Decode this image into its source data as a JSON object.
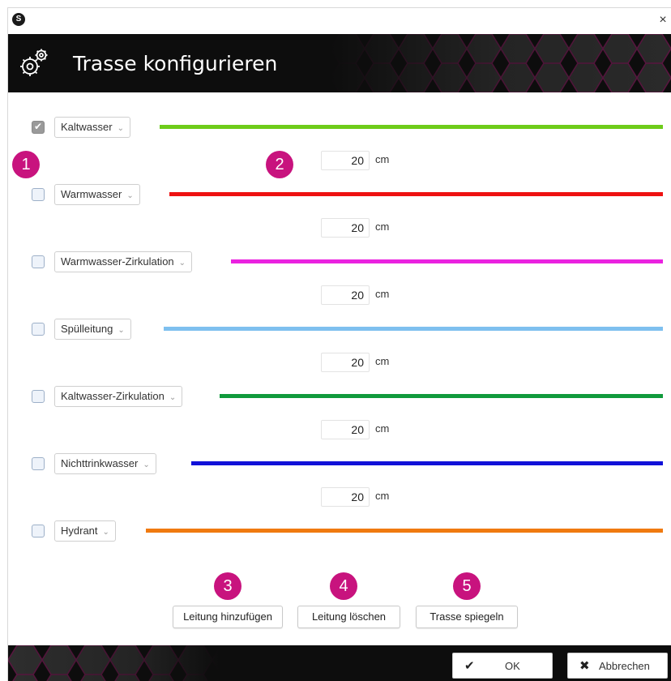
{
  "app_icon": "S",
  "close_glyph": "×",
  "header": {
    "title": "Trasse konfigurieren"
  },
  "rows": [
    {
      "label": "Kaltwasser",
      "checked": true,
      "color": "#6ecc1a"
    },
    {
      "label": "Warmwasser",
      "checked": false,
      "color": "#ee1111"
    },
    {
      "label": "Warmwasser-Zirkulation",
      "checked": false,
      "color": "#ea22e0"
    },
    {
      "label": "Spülleitung",
      "checked": false,
      "color": "#7ec0ef"
    },
    {
      "label": "Kaltwasser-Zirkulation",
      "checked": false,
      "color": "#109a3c"
    },
    {
      "label": "Nichttrinkwasser",
      "checked": false,
      "color": "#1111d8"
    },
    {
      "label": "Hydrant",
      "checked": false,
      "color": "#f07a10"
    }
  ],
  "spacings": [
    {
      "value": "20",
      "unit": "cm"
    },
    {
      "value": "20",
      "unit": "cm"
    },
    {
      "value": "20",
      "unit": "cm"
    },
    {
      "value": "20",
      "unit": "cm"
    },
    {
      "value": "20",
      "unit": "cm"
    },
    {
      "value": "20",
      "unit": "cm"
    }
  ],
  "badges": [
    "1",
    "2",
    "3",
    "4",
    "5"
  ],
  "actions": {
    "add_line": "Leitung hinzufügen",
    "delete_line": "Leitung löschen",
    "mirror": "Trasse spiegeln"
  },
  "footer": {
    "ok": "OK",
    "cancel": "Abbrechen"
  },
  "accent_color": "#c8137e"
}
